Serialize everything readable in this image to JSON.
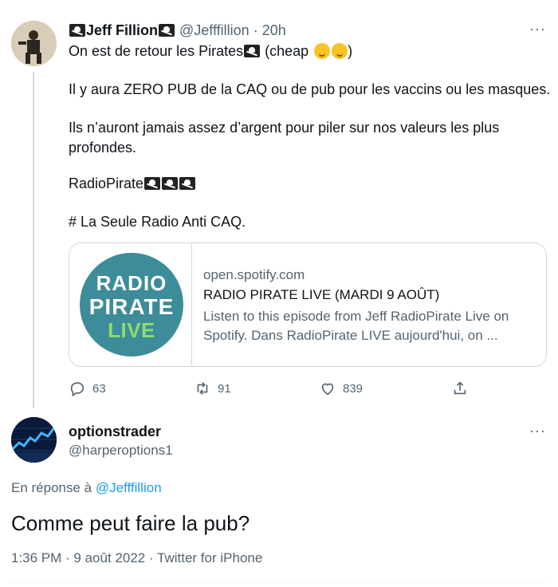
{
  "tweet": {
    "author_name": "Jeff Fillion",
    "handle": "@Jefffillion",
    "time": "20h",
    "more_label": "···",
    "lines": {
      "l1": "On est de retour les Pirates",
      "l1b": " (cheap ",
      "l1c": ")",
      "l2": "Il y aura ZERO PUB de la CAQ ou de pub pour les vaccins ou les masques.",
      "l3": "Ils n’auront jamais assez d’argent pour piler sur nos valeurs les plus",
      "l4": "profondes.",
      "l5": "RadioPirate",
      "l6": "# La Seule Radio Anti CAQ."
    },
    "card": {
      "logo_line1": "RADIO",
      "logo_line2": "PIRATE",
      "logo_line3": "LIVE",
      "domain": "open.spotify.com",
      "title": "RADIO PIRATE LIVE (MARDI 9 AOÛT)",
      "description": "Listen to this episode from Jeff RadioPirate Live on Spotify. Dans RadioPirate LIVE aujourd'hui, on ..."
    },
    "actions": {
      "replies": "63",
      "retweets": "91",
      "likes": "839"
    }
  },
  "reply": {
    "author_name": "optionstrader",
    "handle": "@harperoptions1",
    "more_label": "···",
    "reply_prefix": "En réponse à ",
    "reply_to": "@Jefffillion",
    "text": "Comme peut faire la pub?",
    "meta": "1:36 PM · 9 août 2022 · Twitter for iPhone"
  },
  "icons": [
    "pirate-flag-icon",
    "emoji-icon",
    "reply-icon",
    "retweet-icon",
    "like-icon",
    "share-icon"
  ],
  "colors": {
    "link": "#1d9bf0",
    "muted": "#536471",
    "logo_bg": "#3d8c99",
    "logo_live": "#8fdc6d"
  }
}
